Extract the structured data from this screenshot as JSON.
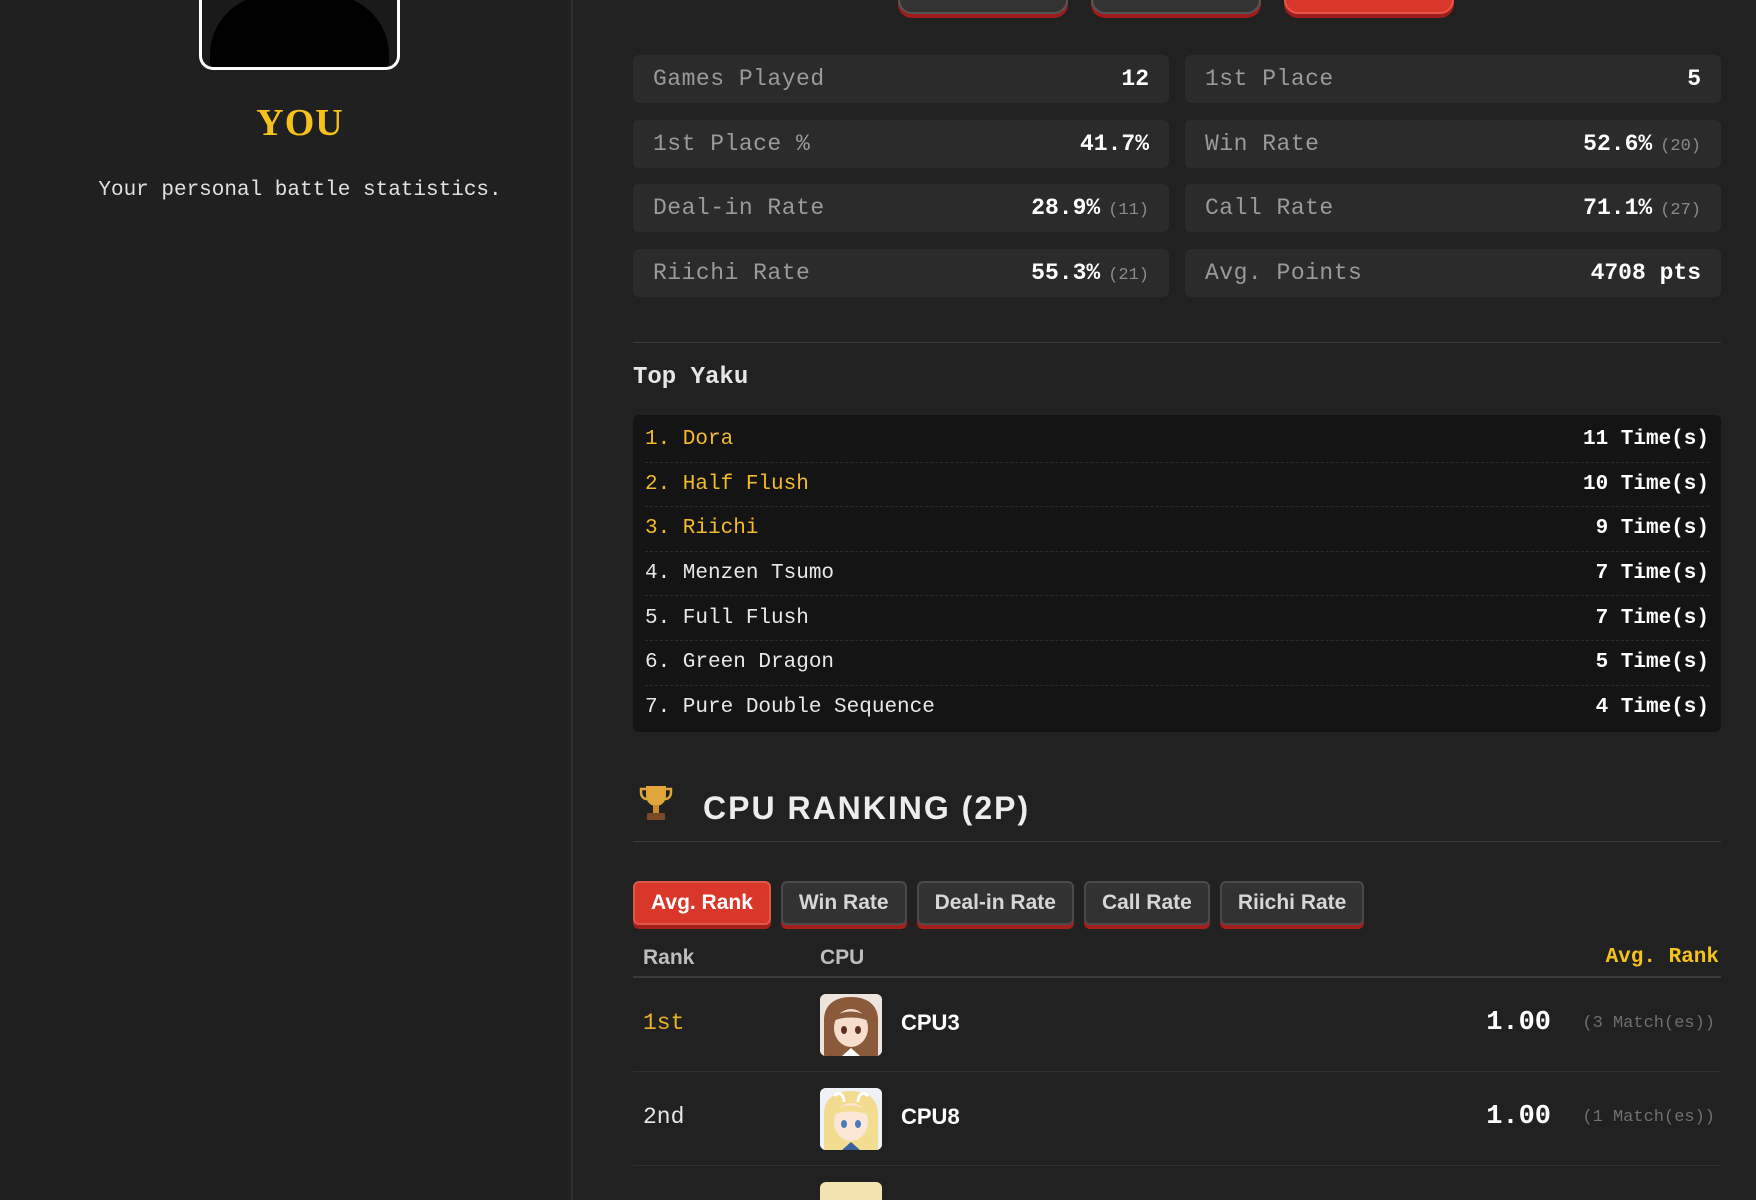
{
  "player": {
    "name": "YOU",
    "description": "Your personal battle statistics."
  },
  "stats": {
    "games_played": {
      "label": "Games Played",
      "value": "12",
      "sub": ""
    },
    "first_place": {
      "label": "1st Place",
      "value": "5",
      "sub": ""
    },
    "first_place_pct": {
      "label": "1st Place %",
      "value": "41.7%",
      "sub": ""
    },
    "win_rate": {
      "label": "Win Rate",
      "value": "52.6%",
      "sub": "(20)"
    },
    "deal_in_rate": {
      "label": "Deal-in Rate",
      "value": "28.9%",
      "sub": "(11)"
    },
    "call_rate": {
      "label": "Call Rate",
      "value": "71.1%",
      "sub": "(27)"
    },
    "riichi_rate": {
      "label": "Riichi Rate",
      "value": "55.3%",
      "sub": "(21)"
    },
    "avg_points": {
      "label": "Avg. Points",
      "value": "4708 pts",
      "sub": ""
    }
  },
  "top_yaku": {
    "title": "Top Yaku",
    "items": [
      {
        "name": "1. Dora",
        "count": "11 Time(s)"
      },
      {
        "name": "2. Half Flush",
        "count": "10 Time(s)"
      },
      {
        "name": "3. Riichi",
        "count": "9 Time(s)"
      },
      {
        "name": "4. Menzen Tsumo",
        "count": "7 Time(s)"
      },
      {
        "name": "5. Full Flush",
        "count": "7 Time(s)"
      },
      {
        "name": "6. Green Dragon",
        "count": "5 Time(s)"
      },
      {
        "name": "7. Pure Double Sequence",
        "count": "4 Time(s)"
      }
    ]
  },
  "cpu_ranking": {
    "icon": "trophy-icon",
    "title": "CPU RANKING (2P)",
    "tabs": [
      "Avg. Rank",
      "Win Rate",
      "Deal-in Rate",
      "Call Rate",
      "Riichi Rate"
    ],
    "active_tab": "Avg. Rank",
    "headers": {
      "rank": "Rank",
      "cpu": "CPU",
      "metric": "Avg. Rank"
    },
    "rows": [
      {
        "rank": "1st",
        "cpu": "CPU3",
        "value": "1.00",
        "matches": "(3 Match(es))"
      },
      {
        "rank": "2nd",
        "cpu": "CPU8",
        "value": "1.00",
        "matches": "(1 Match(es))"
      }
    ]
  },
  "colors": {
    "accent_red": "#d9372a",
    "gold": "#f4c21b",
    "background": "#212121"
  }
}
